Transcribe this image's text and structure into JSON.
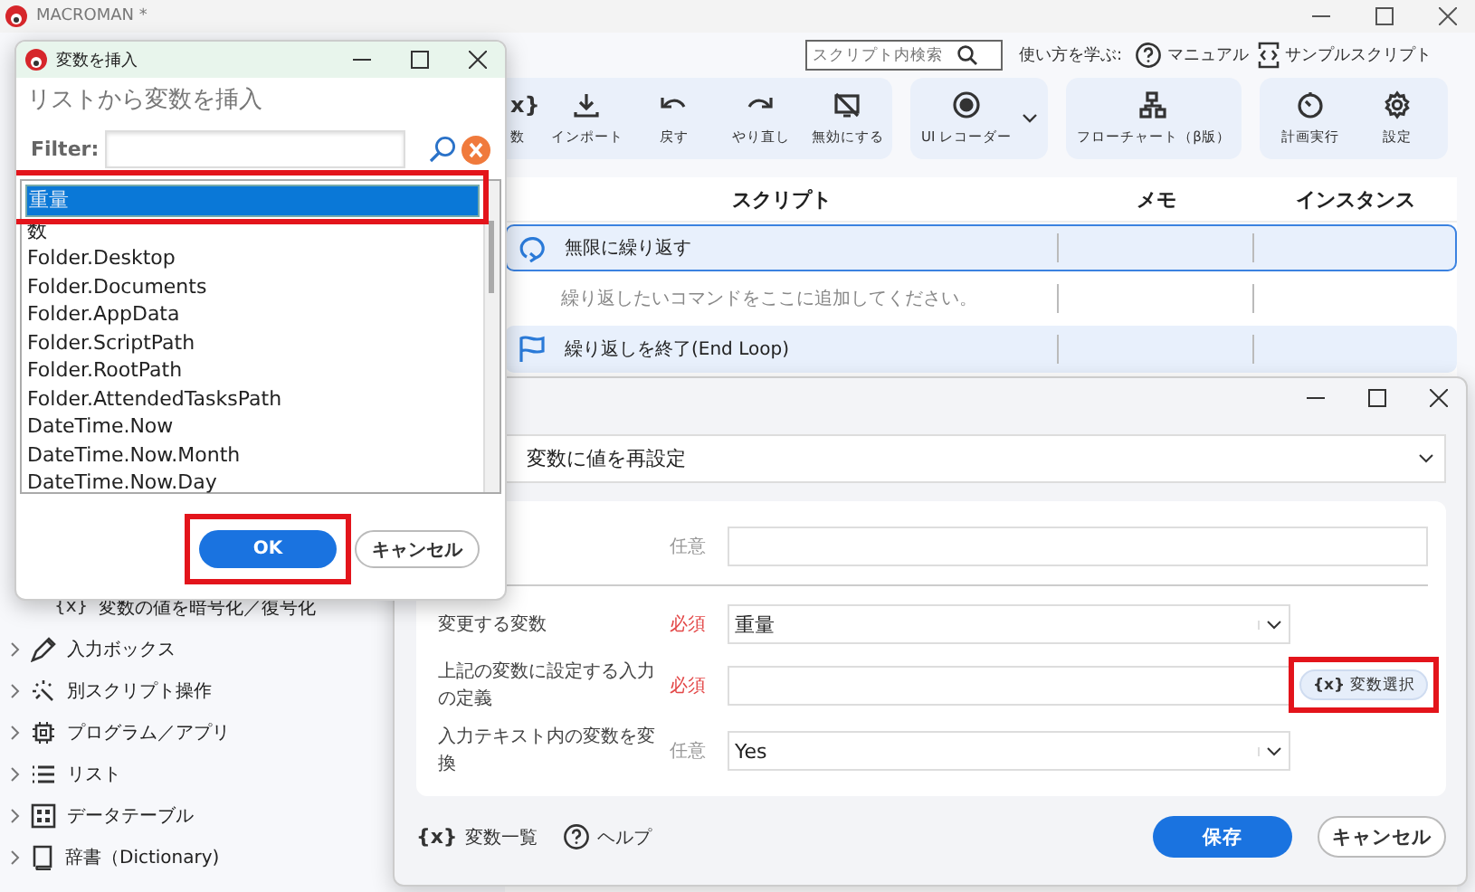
{
  "app": {
    "title": "MACROMAN *",
    "search": {
      "placeholder": "スクリプト内検索"
    },
    "learn_label": "使い方を学ぶ:",
    "links": [
      {
        "kind": "manual",
        "label": "マニュアル"
      },
      {
        "kind": "sample",
        "label": "サンプルスクリプト"
      }
    ]
  },
  "toolbar": {
    "groups": [
      {
        "items": [
          {
            "kind": "variable",
            "glyph": "x}",
            "label": "数"
          },
          {
            "kind": "import",
            "label": "インポート"
          },
          {
            "kind": "undo",
            "label": "戻す"
          },
          {
            "kind": "redo",
            "label": "やり直し"
          },
          {
            "kind": "disable",
            "label": "無効にする"
          }
        ]
      },
      {
        "items": [
          {
            "kind": "recorder",
            "label": "UI レコーダー",
            "dropdown": true
          }
        ]
      },
      {
        "items": [
          {
            "kind": "flowchart",
            "label": "フローチャート（β版）"
          }
        ]
      },
      {
        "items": [
          {
            "kind": "schedule",
            "label": "計画実行"
          },
          {
            "kind": "settings",
            "label": "設定"
          }
        ]
      }
    ]
  },
  "script_table": {
    "columns": [
      "スクリプト",
      "メモ",
      "インスタンス"
    ],
    "rows": [
      {
        "kind": "loop",
        "text": "無限に繰り返す",
        "selected": true
      },
      {
        "kind": "placeholder",
        "text": "繰り返したいコマンドをここに追加してください。",
        "selected": false
      },
      {
        "kind": "end",
        "text": "繰り返しを終了(End Loop)",
        "selected": false
      }
    ]
  },
  "sidebar": {
    "items": [
      {
        "kind": "subitem",
        "glyph": "{x}",
        "label": "変数の値を暗号化／復号化"
      },
      {
        "kind": "inputbox",
        "label": "入力ボックス"
      },
      {
        "kind": "script",
        "label": "別スクリプト操作"
      },
      {
        "kind": "program",
        "label": "プログラム／アプリ"
      },
      {
        "kind": "list",
        "label": "リスト"
      },
      {
        "kind": "datatable",
        "label": "データテーブル"
      },
      {
        "kind": "dictionary",
        "label": "辞書（Dictionary)"
      }
    ]
  },
  "set_dialog": {
    "command": "変数に値を再設定",
    "fields": [
      {
        "kind": "text",
        "tag": "任意",
        "required": false
      },
      {
        "kind": "select",
        "label": "変更する変数",
        "tag": "必須",
        "required": true,
        "value": "重量"
      },
      {
        "kind": "text",
        "label": "上記の変数に設定する入力の定義",
        "tag": "必須",
        "required": true,
        "button": {
          "glyph": "{x}",
          "label": "変数選択",
          "highlighted": true
        }
      },
      {
        "kind": "select",
        "label": "入力テキスト内の変数を変換",
        "tag": "任意",
        "required": false,
        "value": "Yes"
      }
    ],
    "links": [
      {
        "kind": "variables",
        "glyph": "{x}",
        "label": "変数一覧"
      },
      {
        "kind": "help",
        "label": "ヘルプ"
      }
    ],
    "buttons": [
      {
        "label": "保存",
        "primary": true
      },
      {
        "label": "キャンセル",
        "primary": false
      }
    ]
  },
  "insert_dialog": {
    "title": "変数を挿入",
    "heading": "リストから変数を挿入",
    "filter_label": "Filter:",
    "items": [
      {
        "label": "重量",
        "selected": true,
        "highlighted": true
      },
      {
        "label": "数",
        "selected": false,
        "highlighted": false
      },
      {
        "label": "Folder.Desktop",
        "selected": false,
        "highlighted": false
      },
      {
        "label": "Folder.Documents",
        "selected": false,
        "highlighted": false
      },
      {
        "label": "Folder.AppData",
        "selected": false,
        "highlighted": false
      },
      {
        "label": "Folder.ScriptPath",
        "selected": false,
        "highlighted": false
      },
      {
        "label": "Folder.RootPath",
        "selected": false,
        "highlighted": false
      },
      {
        "label": "Folder.AttendedTasksPath",
        "selected": false,
        "highlighted": false
      },
      {
        "label": "DateTime.Now",
        "selected": false,
        "highlighted": false
      },
      {
        "label": "DateTime.Now.Month",
        "selected": false,
        "highlighted": false
      },
      {
        "label": "DateTime.Now.Day",
        "selected": false,
        "highlighted": false
      }
    ],
    "buttons": [
      {
        "label": "OK",
        "primary": true,
        "highlighted": true
      },
      {
        "label": "キャンセル",
        "primary": false,
        "highlighted": false
      }
    ]
  }
}
